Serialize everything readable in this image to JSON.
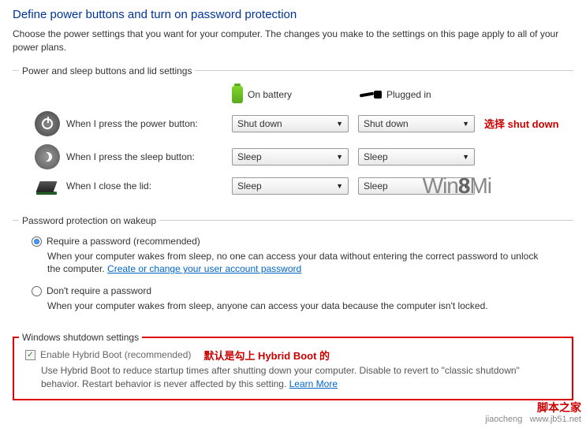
{
  "title": "Define power buttons and turn on password protection",
  "subtitle": "Choose the power settings that you want for your computer. The changes you make to the settings on this page apply to all of your power plans.",
  "buttons_section": {
    "legend": "Power and sleep buttons and lid settings",
    "col1": "On battery",
    "col2": "Plugged in",
    "rows": [
      {
        "label": "When I press the power button:",
        "battery": "Shut down",
        "plugged": "Shut down"
      },
      {
        "label": "When I press the sleep button:",
        "battery": "Sleep",
        "plugged": "Sleep"
      },
      {
        "label": "When I close the lid:",
        "battery": "Sleep",
        "plugged": "Sleep"
      }
    ],
    "annotation": "选择 shut down"
  },
  "password_section": {
    "legend": "Password protection on wakeup",
    "opt1_label": "Require a password (recommended)",
    "opt1_desc": "When your computer wakes from sleep, no one can access your data without entering the correct password to unlock the computer. ",
    "opt1_link": "Create or change your user account password",
    "opt2_label": "Don't require a password",
    "opt2_desc": "When your computer wakes from sleep, anyone can access your data because the computer isn't locked."
  },
  "shutdown_section": {
    "legend": "Windows shutdown settings",
    "cb_label": "Enable Hybrid Boot (recommended)",
    "annotation": "默认是勾上 Hybrid Boot 的",
    "desc": "Use Hybrid Boot to reduce startup times after shutting down your computer. Disable to revert to \"classic shutdown\" behavior. Restart behavior is never affected by this setting. ",
    "link": "Learn More"
  },
  "watermark": {
    "part1": "Win",
    "part2": "8",
    "part3": "Mi"
  },
  "corner": {
    "red": "脚本之家",
    "grey": "jiaocheng",
    "url": "www.jb51.net"
  }
}
